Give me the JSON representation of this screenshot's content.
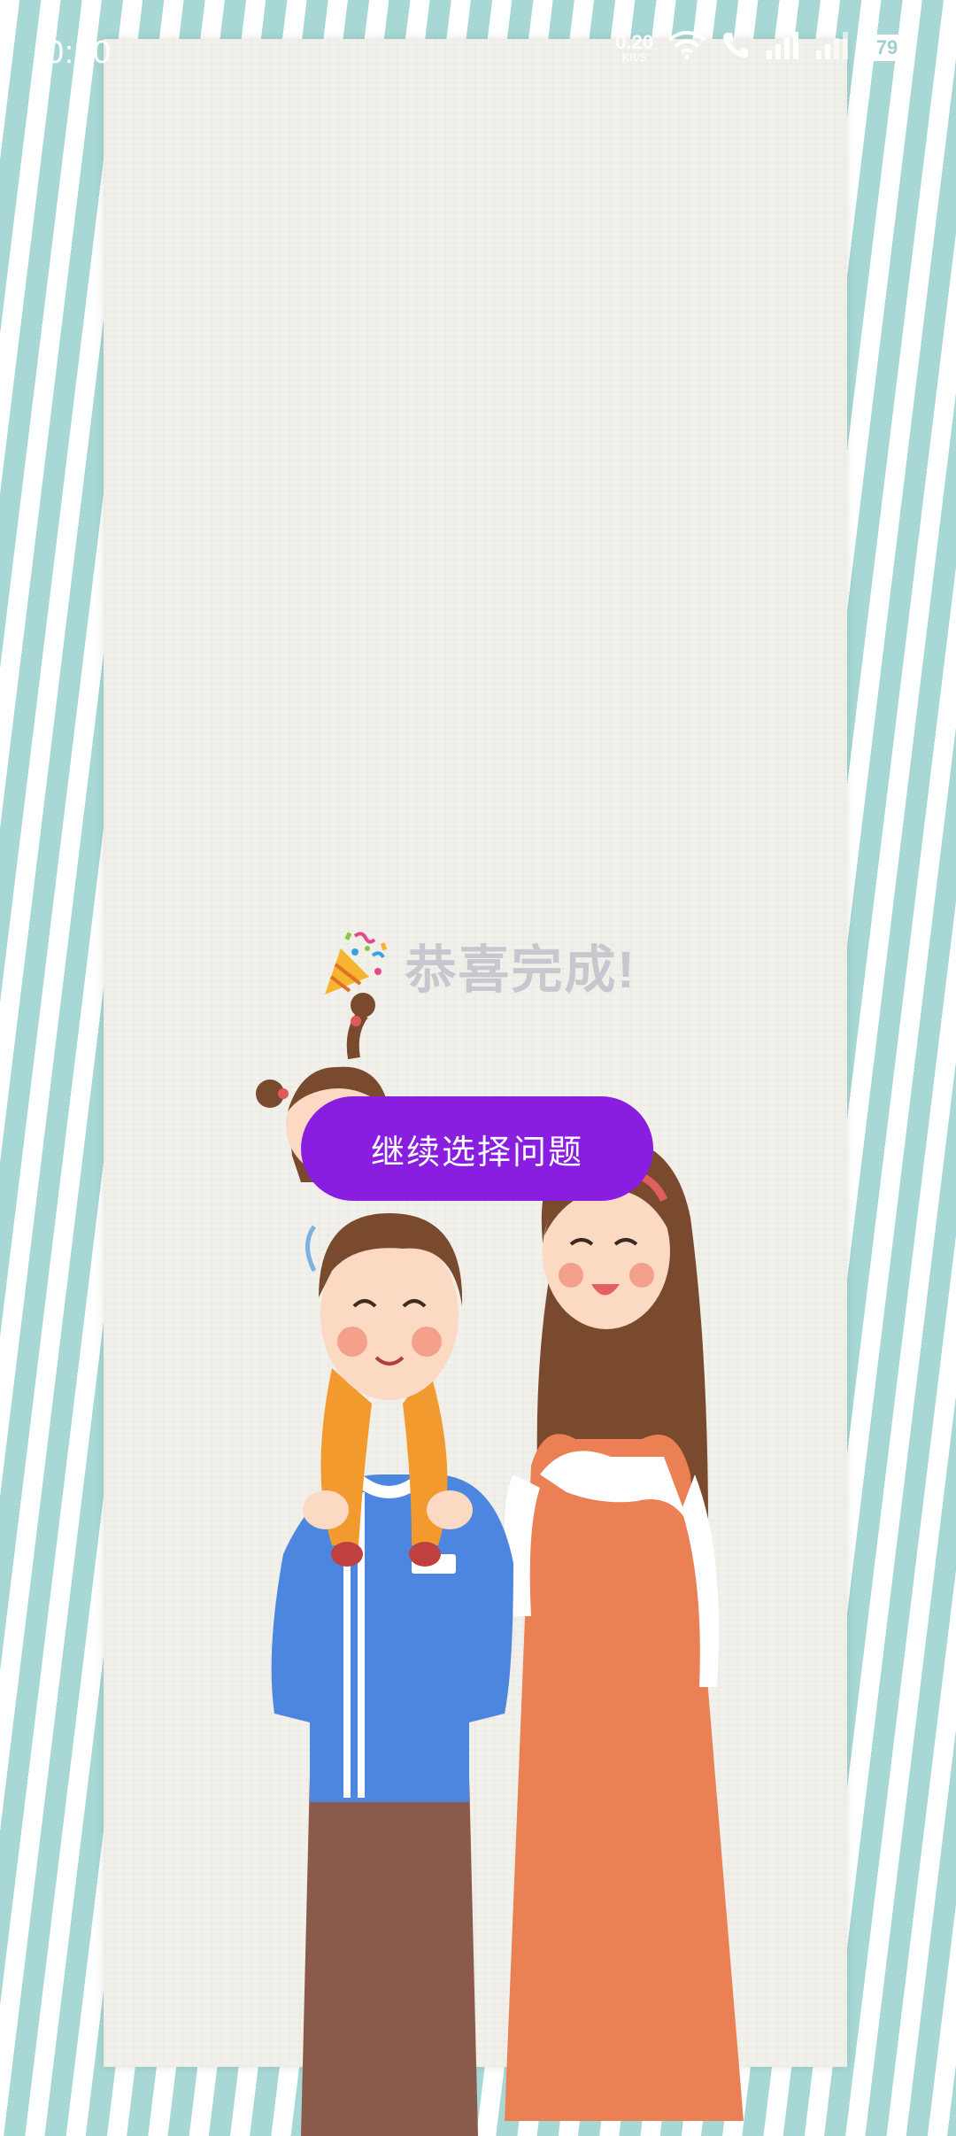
{
  "status_bar": {
    "time": "0:20",
    "net_speed_value": "0.20",
    "net_speed_unit": "KB/S",
    "battery": "79",
    "icons": [
      "wifi-icon",
      "call-icon",
      "signal-icon",
      "signal-icon"
    ]
  },
  "congrats": {
    "icon": "party-popper-icon",
    "text": "恭喜完成!"
  },
  "continue_button": {
    "label": "继续选择问题"
  },
  "colors": {
    "stripe": "#a7d8d5",
    "paper": "#f2f0ea",
    "button": "#8a1ee0",
    "congrats_text": "#c8c6ce"
  }
}
